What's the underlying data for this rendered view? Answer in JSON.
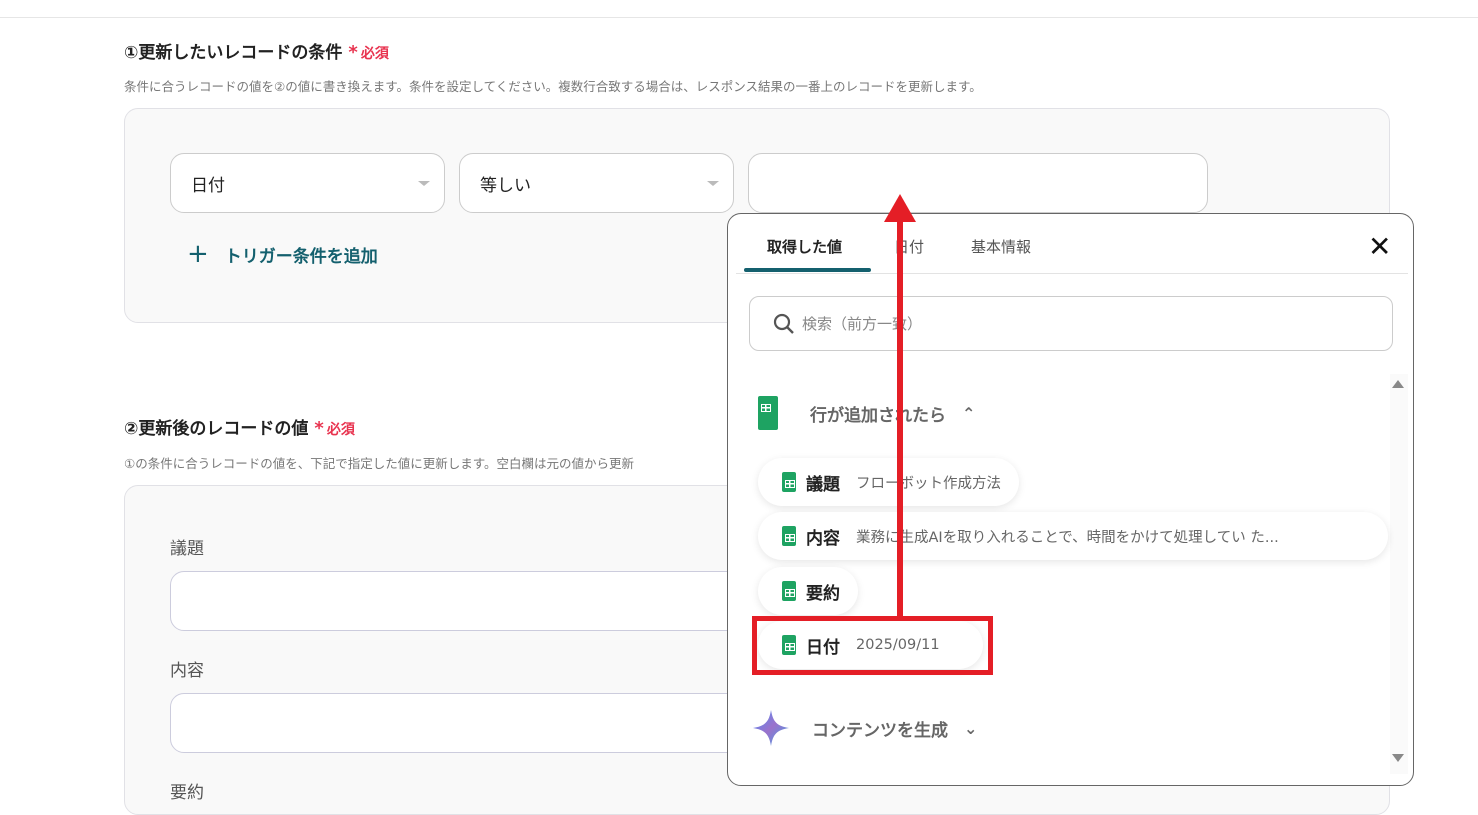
{
  "section1": {
    "title": "①更新したいレコードの条件",
    "required": "必須",
    "description": "条件に合うレコードの値を②の値に書き換えます。条件を設定してください。複数行合致する場合は、レスポンス結果の一番上のレコードを更新します。",
    "field_select": "日付",
    "operator_select": "等しい",
    "value_input": "",
    "add_condition": "トリガー条件を追加"
  },
  "section2": {
    "title": "②更新後のレコードの値",
    "required": "必須",
    "description": "①の条件に合うレコードの値を、下記で指定した値に更新します。空白欄は元の値から更新",
    "fields": [
      {
        "label": "議題"
      },
      {
        "label": "内容"
      },
      {
        "label": "要約"
      }
    ]
  },
  "popup": {
    "tabs": [
      "取得した値",
      "日付",
      "基本情報"
    ],
    "search_placeholder": "検索（前方一致）",
    "group1": "行が追加されたら",
    "items": [
      {
        "key": "議題",
        "value": "フローボット作成方法"
      },
      {
        "key": "内容",
        "value": "業務に生成AIを取り入れることで、時間をかけて処理してい た..."
      },
      {
        "key": "要約",
        "value": ""
      },
      {
        "key": "日付",
        "value": "2025/09/11"
      }
    ],
    "group2": "コンテンツを生成"
  },
  "colors": {
    "accent": "#14606e",
    "required": "#e8334f",
    "annotation": "#e41e26",
    "sheets": "#1ea362"
  }
}
